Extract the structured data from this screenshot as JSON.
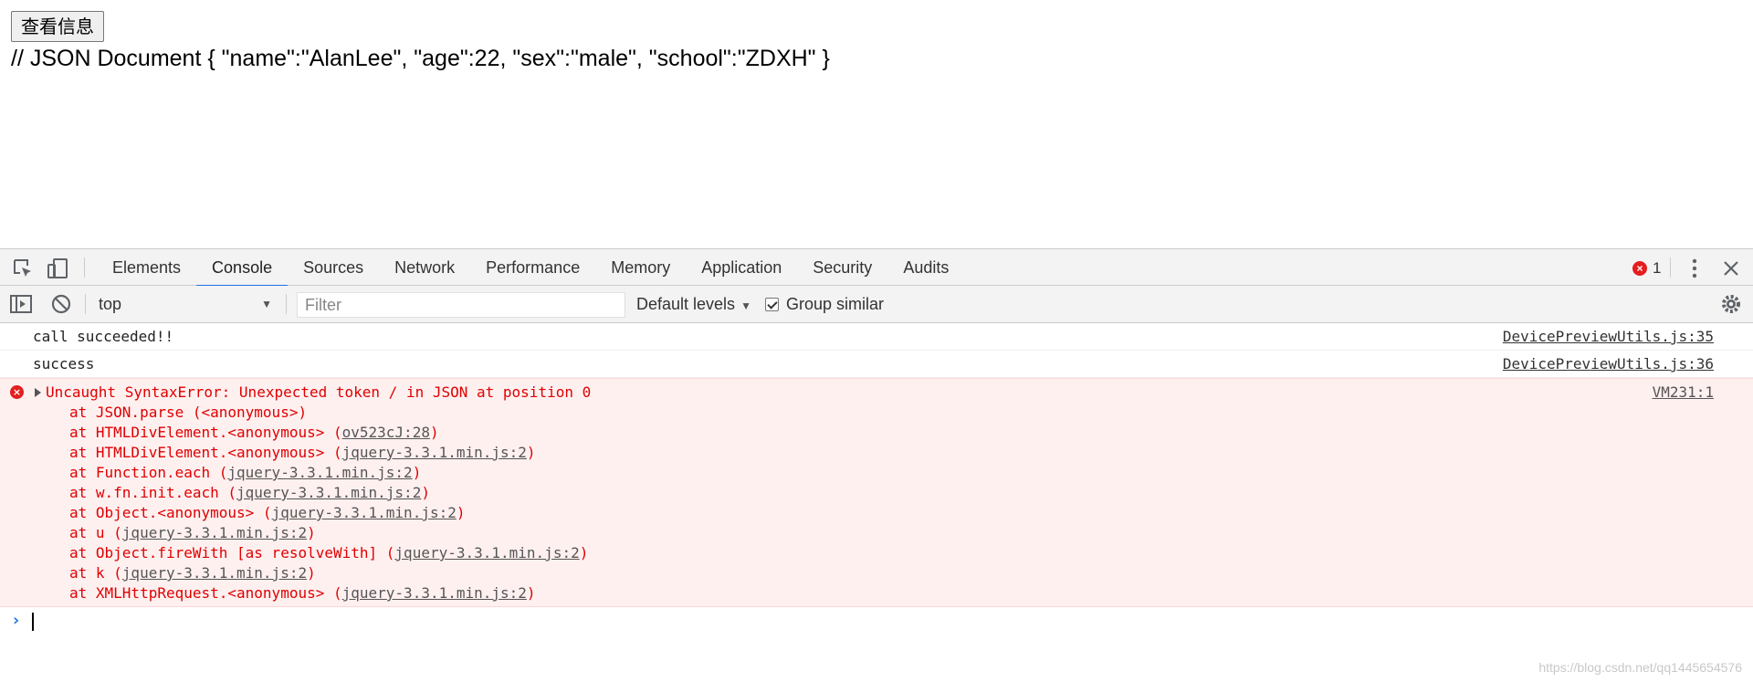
{
  "page": {
    "button_label": "查看信息",
    "json_text": "// JSON Document { \"name\":\"AlanLee\", \"age\":22, \"sex\":\"male\", \"school\":\"ZDXH\" }"
  },
  "devtools": {
    "tabs": [
      "Elements",
      "Console",
      "Sources",
      "Network",
      "Performance",
      "Memory",
      "Application",
      "Security",
      "Audits"
    ],
    "active_tab": "Console",
    "error_count": "1",
    "toolbar": {
      "context": "top",
      "filter_placeholder": "Filter",
      "levels": "Default levels",
      "group_similar": "Group similar"
    },
    "messages": [
      {
        "text": "call succeeded!!",
        "source": "DevicePreviewUtils.js:35"
      },
      {
        "text": "success",
        "source": "DevicePreviewUtils.js:36"
      }
    ],
    "error": {
      "head": "Uncaught SyntaxError: Unexpected token / in JSON at position 0",
      "source": "VM231:1",
      "stack": [
        {
          "pre": "at JSON.parse (<anonymous>)",
          "link": "",
          "post": ""
        },
        {
          "pre": "at HTMLDivElement.<anonymous> (",
          "link": "ov523cJ:28",
          "post": ")"
        },
        {
          "pre": "at HTMLDivElement.<anonymous> (",
          "link": "jquery-3.3.1.min.js:2",
          "post": ")"
        },
        {
          "pre": "at Function.each (",
          "link": "jquery-3.3.1.min.js:2",
          "post": ")"
        },
        {
          "pre": "at w.fn.init.each (",
          "link": "jquery-3.3.1.min.js:2",
          "post": ")"
        },
        {
          "pre": "at Object.<anonymous> (",
          "link": "jquery-3.3.1.min.js:2",
          "post": ")"
        },
        {
          "pre": "at u (",
          "link": "jquery-3.3.1.min.js:2",
          "post": ")"
        },
        {
          "pre": "at Object.fireWith [as resolveWith] (",
          "link": "jquery-3.3.1.min.js:2",
          "post": ")"
        },
        {
          "pre": "at k (",
          "link": "jquery-3.3.1.min.js:2",
          "post": ")"
        },
        {
          "pre": "at XMLHttpRequest.<anonymous> (",
          "link": "jquery-3.3.1.min.js:2",
          "post": ")"
        }
      ]
    }
  },
  "watermark": "https://blog.csdn.net/qq1445654576",
  "colors": {
    "accent": "#1a73e8",
    "error": "#e00000",
    "error_bg": "#fff0f0"
  }
}
